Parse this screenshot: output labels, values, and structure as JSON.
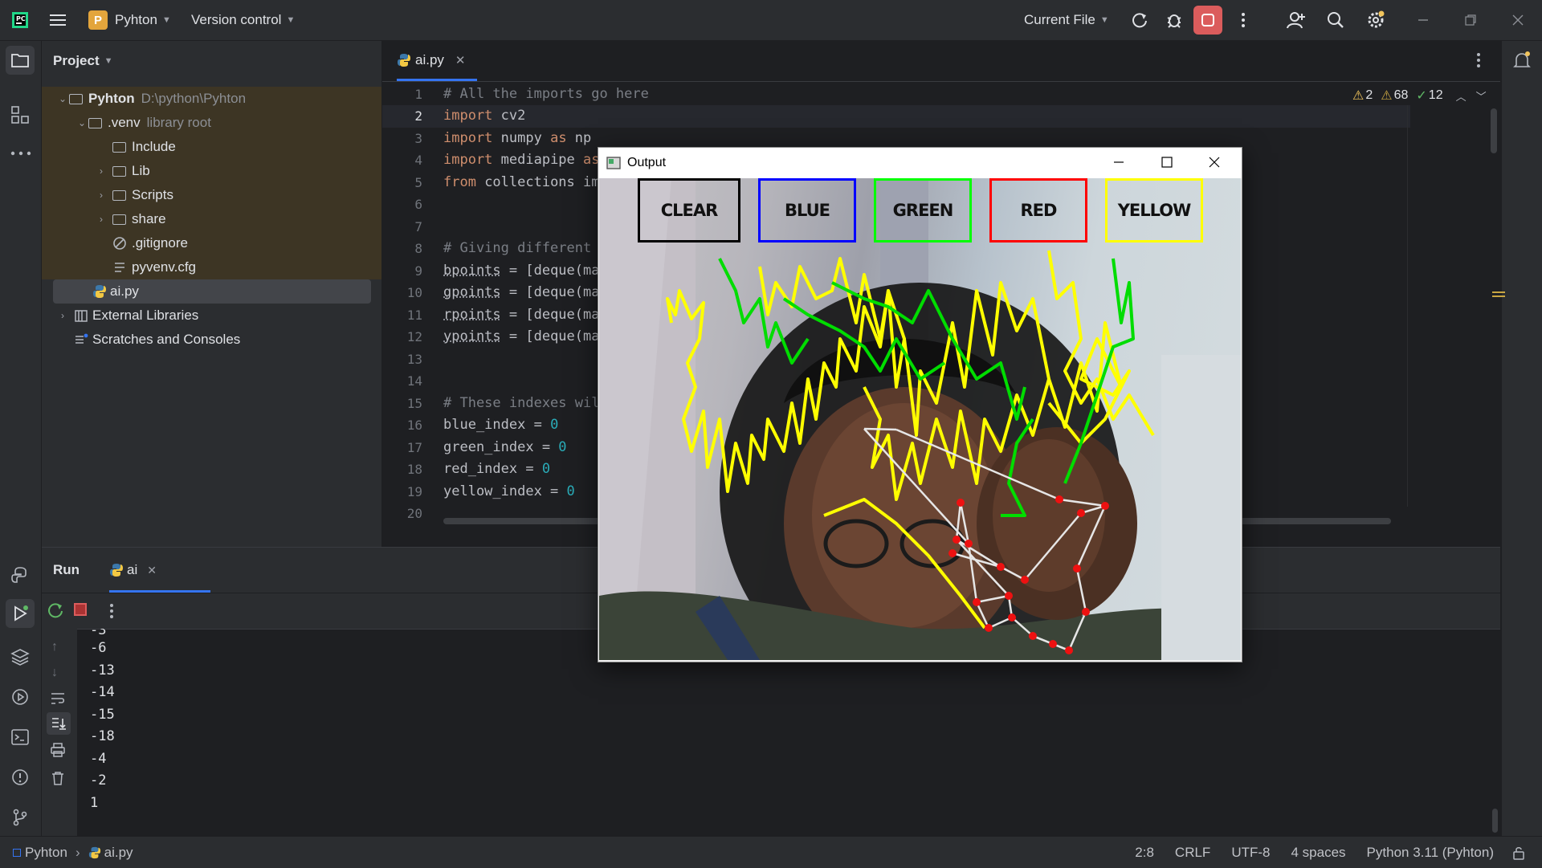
{
  "titlebar": {
    "project_badge": "P",
    "project_name": "Pyhton",
    "vcs": "Version control",
    "run_config": "Current File"
  },
  "colors": {
    "accent": "#3574f0",
    "stop": "#db5c5c",
    "project_badge": "#e3a53c",
    "venv_highlight": "#3d3524"
  },
  "project_panel": {
    "title": "Project",
    "tree": [
      {
        "label": "Pyhton",
        "hint": "D:\\python\\Pyhton",
        "type": "folder",
        "expanded": true
      },
      {
        "label": ".venv",
        "hint": "library root",
        "type": "folder",
        "expanded": true
      },
      {
        "label": "Include",
        "hint": "",
        "type": "folder"
      },
      {
        "label": "Lib",
        "hint": "",
        "type": "folder"
      },
      {
        "label": "Scripts",
        "hint": "",
        "type": "folder"
      },
      {
        "label": "share",
        "hint": "",
        "type": "folder"
      },
      {
        "label": ".gitignore",
        "hint": "",
        "type": "ignore-file"
      },
      {
        "label": "pyvenv.cfg",
        "hint": "",
        "type": "config-file"
      },
      {
        "label": "ai.py",
        "hint": "",
        "type": "python-file"
      },
      {
        "label": "External Libraries",
        "hint": "",
        "type": "library"
      },
      {
        "label": "Scratches and Consoles",
        "hint": "",
        "type": "scratches"
      }
    ]
  },
  "editor": {
    "tab": "ai.py",
    "inspections": {
      "warnings": "2",
      "weak_warnings": "68",
      "ok": "12"
    },
    "line_numbers": [
      "1",
      "2",
      "3",
      "4",
      "5",
      "6",
      "7",
      "8",
      "9",
      "10",
      "11",
      "12",
      "13",
      "14",
      "15",
      "16",
      "17",
      "18",
      "19",
      "20"
    ],
    "lines": [
      "# All the imports go here",
      "import cv2",
      "import numpy as np",
      "import mediapipe as",
      "from collections im",
      "",
      "",
      "# Giving different ",
      "bpoints = [deque(ma",
      "gpoints = [deque(ma",
      "rpoints = [deque(ma",
      "ypoints = [deque(ma",
      "",
      "",
      "# These indexes wil",
      "blue_index = 0",
      "green_index = 0",
      "red_index = 0",
      "yellow_index = 0",
      ""
    ]
  },
  "run_panel": {
    "title": "Run",
    "tab": "ai",
    "partial_top": "-3",
    "output": [
      "-6",
      "-13",
      "-14",
      "-15",
      "-18",
      "-4",
      "-2",
      "1"
    ]
  },
  "output_window": {
    "title": "Output",
    "buttons": [
      {
        "label": "CLEAR",
        "color": "#000000"
      },
      {
        "label": "BLUE",
        "color": "#0000ff"
      },
      {
        "label": "GREEN",
        "color": "#00ff00"
      },
      {
        "label": "RED",
        "color": "#ff0000"
      },
      {
        "label": "YELLOW",
        "color": "#ffff00"
      }
    ]
  },
  "statusbar": {
    "crumb_project": "Pyhton",
    "crumb_file": "ai.py",
    "position": "2:8",
    "line_sep": "CRLF",
    "encoding": "UTF-8",
    "indent": "4 spaces",
    "interpreter": "Python 3.11 (Pyhton)"
  }
}
